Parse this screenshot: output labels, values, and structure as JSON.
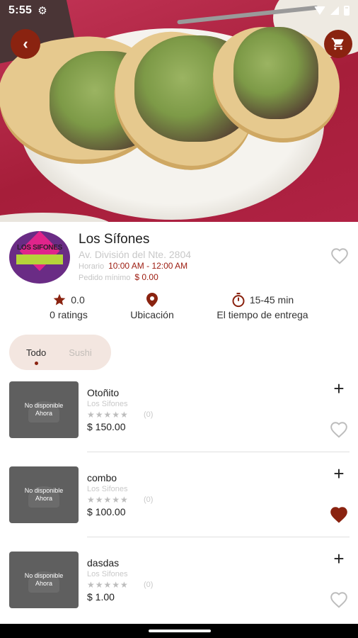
{
  "status_bar": {
    "time": "5:55"
  },
  "restaurant": {
    "name": "Los Sífones",
    "address": "Av. División del Nte. 2804",
    "hours_label": "Horario",
    "hours_value": "10:00 AM - 12:00 AM",
    "min_order_label": "Pedido mínimo",
    "min_order_value": "$ 0.00",
    "logo_text": "LOS SIFONES",
    "favorite": false
  },
  "stats": {
    "rating_value": "0.0",
    "rating_label": "0 ratings",
    "location_label": "Ubicación",
    "delivery_value": "15-45 min",
    "delivery_label": "El tiempo de entrega"
  },
  "filters": [
    {
      "label": "Todo",
      "active": true
    },
    {
      "label": "Sushi",
      "active": false
    }
  ],
  "products": [
    {
      "name": "Otoñito",
      "restaurant": "Los Sifones",
      "rating": "★★★★★",
      "rating_count": "(0)",
      "price": "$ 150.00",
      "image_text_1": "No disponible",
      "image_text_2": "Ahora",
      "favorite": false
    },
    {
      "name": "combo",
      "restaurant": "Los Sifones",
      "rating": "★★★★★",
      "rating_count": "(0)",
      "price": "$ 100.00",
      "image_text_1": "No disponible",
      "image_text_2": "Ahora",
      "favorite": true
    },
    {
      "name": "dasdas",
      "restaurant": "Los Sifones",
      "rating": "★★★★★",
      "rating_count": "(0)",
      "price": "$ 1.00",
      "image_text_1": "No disponible",
      "image_text_2": "Ahora",
      "favorite": false
    }
  ],
  "colors": {
    "accent": "#8a2310",
    "price_red": "#9c1b0f",
    "chip_bg": "#f3e6e0",
    "heart_filled": "#8a2310",
    "heart_outline": "#bdbdbd"
  },
  "icons": {
    "back": "arrow-left-icon",
    "cart": "shopping-cart-icon",
    "heart": "heart-icon",
    "star": "star-icon",
    "location": "map-pin-icon",
    "timer": "timer-icon",
    "add": "plus-icon"
  }
}
